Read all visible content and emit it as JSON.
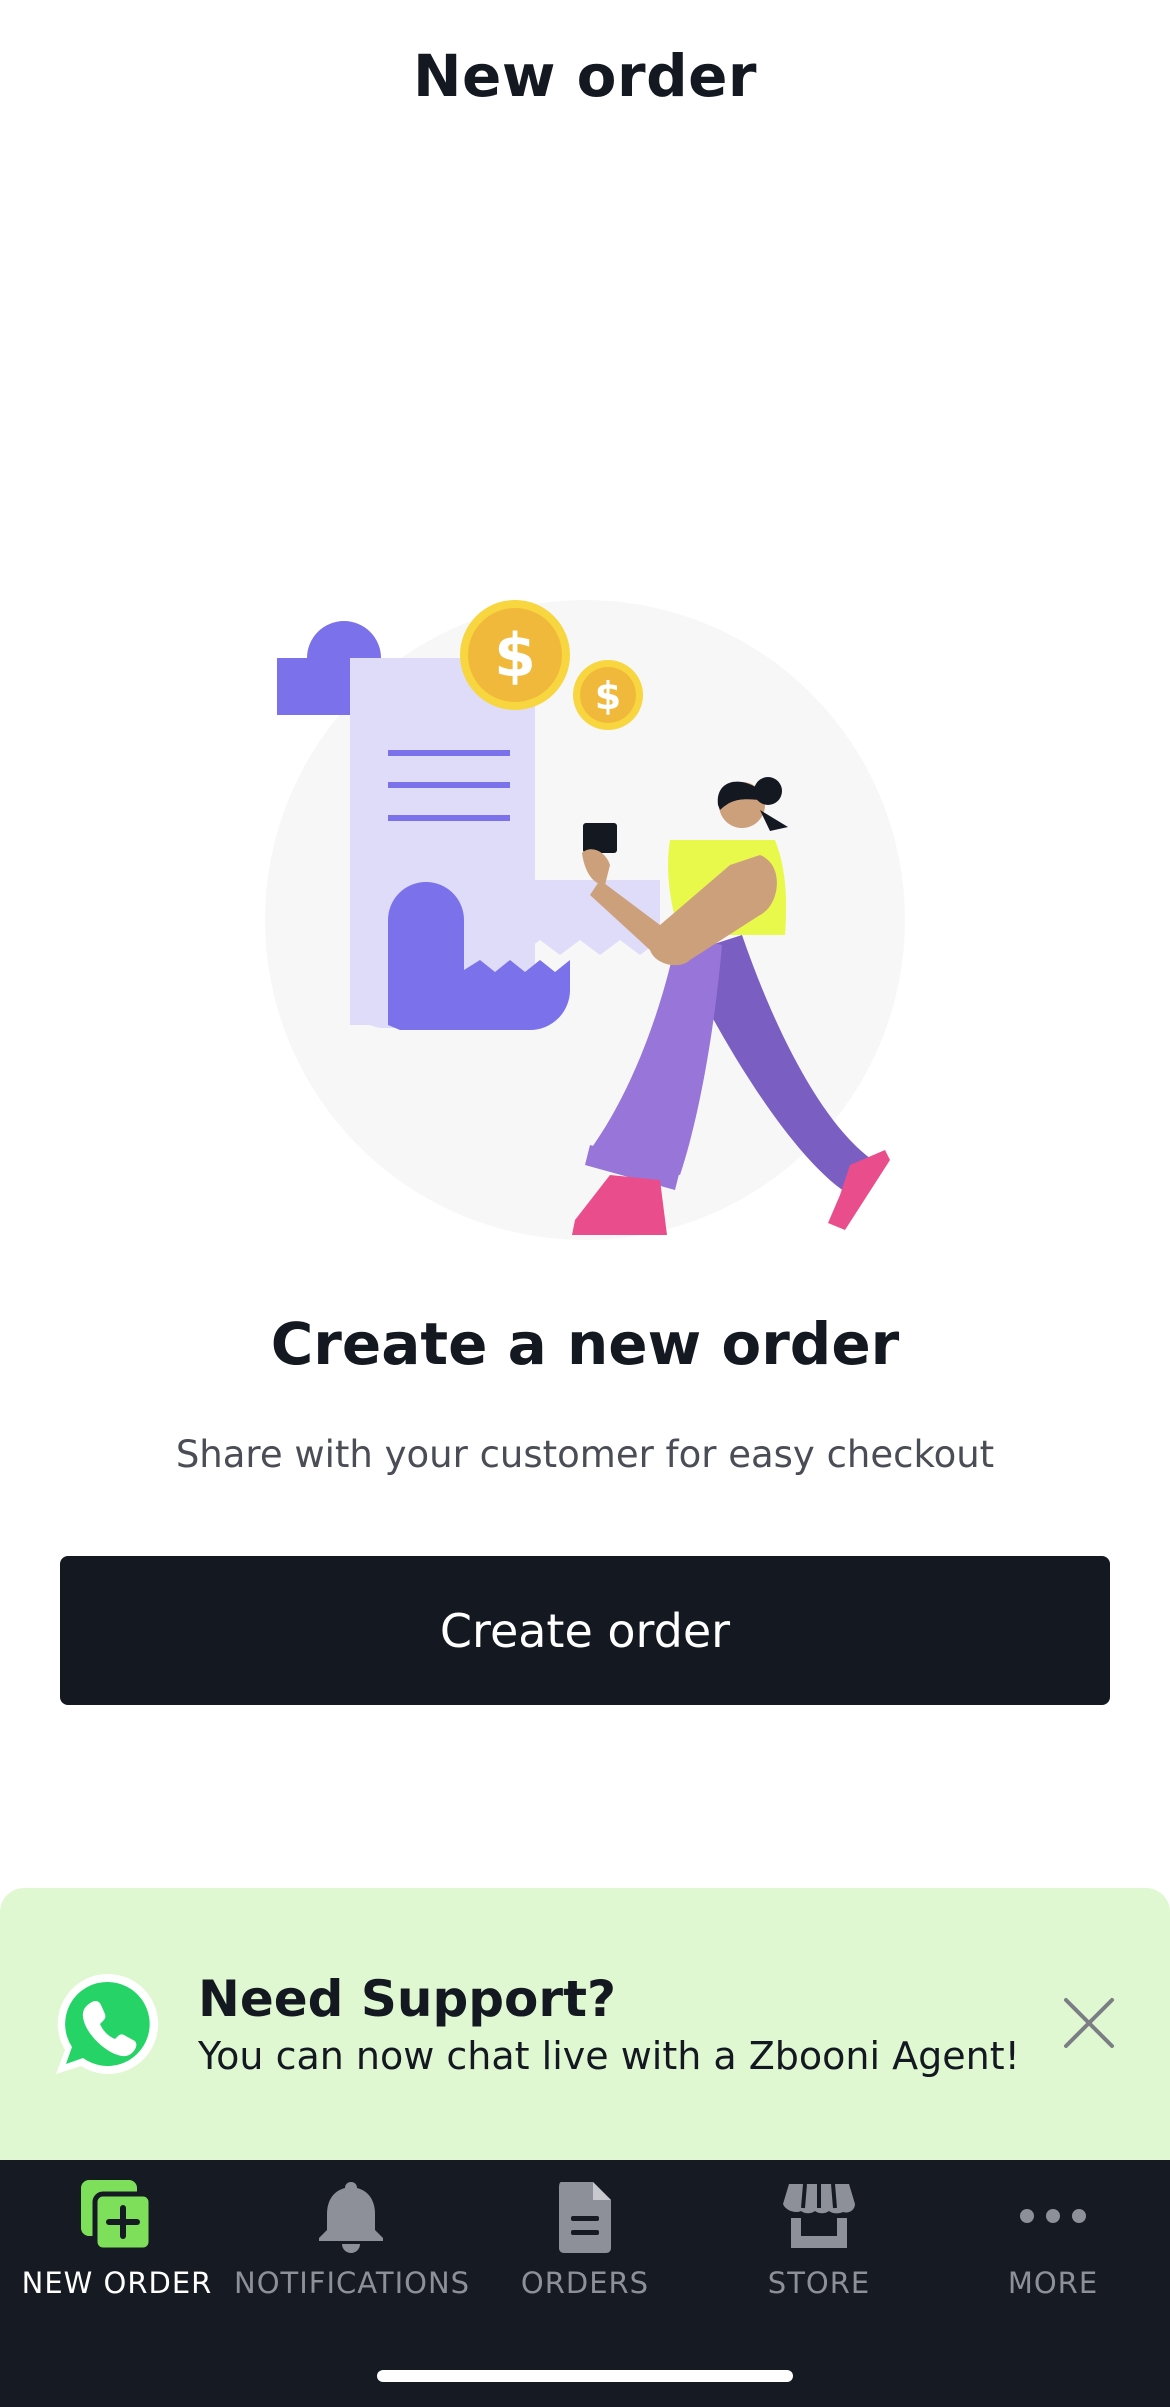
{
  "header": {
    "title": "New order"
  },
  "empty_state": {
    "title": "Create a new order",
    "subtitle": "Share with your customer for easy checkout",
    "illustration": "receipt-payment-illustration",
    "coin_symbol": "$"
  },
  "primary_action": {
    "label": "Create order"
  },
  "support_banner": {
    "title": "Need Support?",
    "text": "You can now chat live with a Zbooni Agent!",
    "icon": "whatsapp-icon",
    "close_icon": "close-icon"
  },
  "bottom_nav": {
    "items": [
      {
        "label": "NEW ORDER",
        "icon": "new-order-icon",
        "active": true
      },
      {
        "label": "NOTIFICATIONS",
        "icon": "bell-icon",
        "active": false
      },
      {
        "label": "ORDERS",
        "icon": "document-icon",
        "active": false
      },
      {
        "label": "STORE",
        "icon": "store-icon",
        "active": false
      },
      {
        "label": "MORE",
        "icon": "more-icon",
        "active": false
      }
    ]
  },
  "colors": {
    "primary": "#141821",
    "banner_bg": "#dff8d1",
    "whatsapp": "#25d366",
    "nav_bg": "#161a23",
    "nav_active_icon": "#7ee05a",
    "nav_inactive": "#8d9098"
  }
}
